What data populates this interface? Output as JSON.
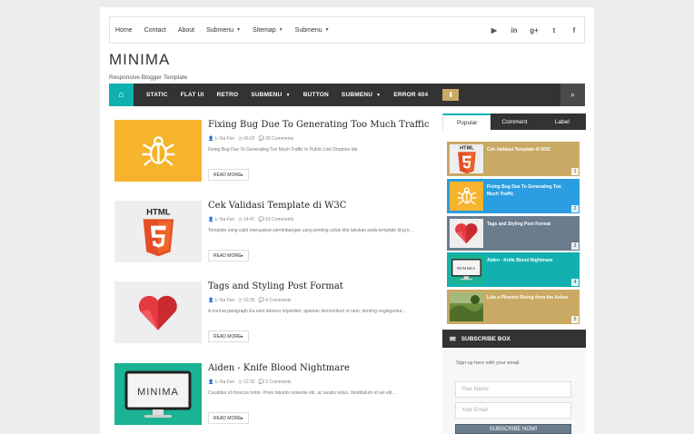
{
  "topnav": {
    "items": [
      {
        "label": "Home",
        "caret": false
      },
      {
        "label": "Contact",
        "caret": false
      },
      {
        "label": "About",
        "caret": false
      },
      {
        "label": "Submenu",
        "caret": true
      },
      {
        "label": "Sitemap",
        "caret": true
      },
      {
        "label": "Submenu",
        "caret": true
      }
    ],
    "socials": [
      {
        "icon": "youtube-icon",
        "glyph": "▶"
      },
      {
        "icon": "linkedin-icon",
        "glyph": "in"
      },
      {
        "icon": "googleplus-icon",
        "glyph": "g+"
      },
      {
        "icon": "twitter-icon",
        "glyph": "t"
      },
      {
        "icon": "facebook-icon",
        "glyph": "f"
      }
    ]
  },
  "brand": {
    "title": "MINIMA",
    "tagline": "Responsive Blogger Template"
  },
  "mainnav": {
    "home_glyph": "⌂",
    "items": [
      {
        "label": "STATIC",
        "caret": false
      },
      {
        "label": "FLAT UI",
        "caret": false
      },
      {
        "label": "RETRO",
        "caret": false
      },
      {
        "label": "SUBMENU",
        "caret": true
      },
      {
        "label": "BUTTON",
        "caret": false
      },
      {
        "label": "SUBMENU",
        "caret": true
      },
      {
        "label": "ERROR 404",
        "caret": false
      }
    ],
    "download_glyph": "⬇",
    "search_glyph": "⌕"
  },
  "posts": [
    {
      "title": "Fixing Bug Due To Generating Too Much Traffic",
      "author": "Li Na Fen",
      "time": "06:02",
      "comments": "28 Comments",
      "excerpt": "Fixing Bug Due To Generating Too Much Traffic In Public Link Dropbox Ide",
      "readmore": "READ MORE▸",
      "thumb": "bug",
      "thumb_color": "#f6b42c"
    },
    {
      "title": "Cek Validasi Template di W3C",
      "author": "Li Na Fen",
      "time": "14:47",
      "comments": "19 Comments",
      "excerpt": "Template yang valid merupakan pertimbangan yang penting untuk kita lakukan pada template blog k...",
      "readmore": "READ MORE▸",
      "thumb": "html",
      "thumb_color": "#eeeeee"
    },
    {
      "title": "Tags and Styling Post Format",
      "author": "Li Na Fen",
      "time": "22:35",
      "comments": "4 Comments",
      "excerpt": "A normal paragraph Ea eam labores imperdiet, apeirian democritum ei nam, doming neglegentur...",
      "readmore": "READ MORE▸",
      "thumb": "heart",
      "thumb_color": "#eeeeee"
    },
    {
      "title": "Aiden - Knife Blood Nightmare",
      "author": "Li Na Fen",
      "time": "22:32",
      "comments": "3 Comments",
      "excerpt": "Curabitur id rhoncus tortor. Proin lobortis molestie elit, ac iaculis tellus. Vestibulum et vel elit...",
      "readmore": "READ MORE▸",
      "thumb": "monitor",
      "thumb_color": "#1ab394"
    }
  ],
  "sidebar": {
    "tabs": [
      "Popular",
      "Comment",
      "Label"
    ],
    "popular": [
      {
        "title": "Cek Validasi Template di W3C",
        "num": "1",
        "bg": "#c9a964",
        "thumb": "html"
      },
      {
        "title": "Fixing Bug Due To Generating Too Much Traffic",
        "num": "2",
        "bg": "#2a9ee0",
        "thumb": "bug"
      },
      {
        "title": "Tags and Styling Post Format",
        "num": "3",
        "bg": "#6b7c8c",
        "thumb": "heart"
      },
      {
        "title": "Aiden - Knife Blood Nightmare",
        "num": "4",
        "bg": "#12b0b0",
        "thumb": "monitor"
      },
      {
        "title": "Like a Phoenix Rising from the Ashes",
        "num": "5",
        "bg": "#c9a964",
        "thumb": "photo"
      }
    ],
    "subscribe": {
      "heading": "SUBSCRIBE BOX",
      "text": "Sign up here with your email.",
      "name_placeholder": "Your Name",
      "email_placeholder": "Your Email",
      "button": "SUBSCRIBE NOW!"
    }
  },
  "monitor_logo": "MINIMA"
}
